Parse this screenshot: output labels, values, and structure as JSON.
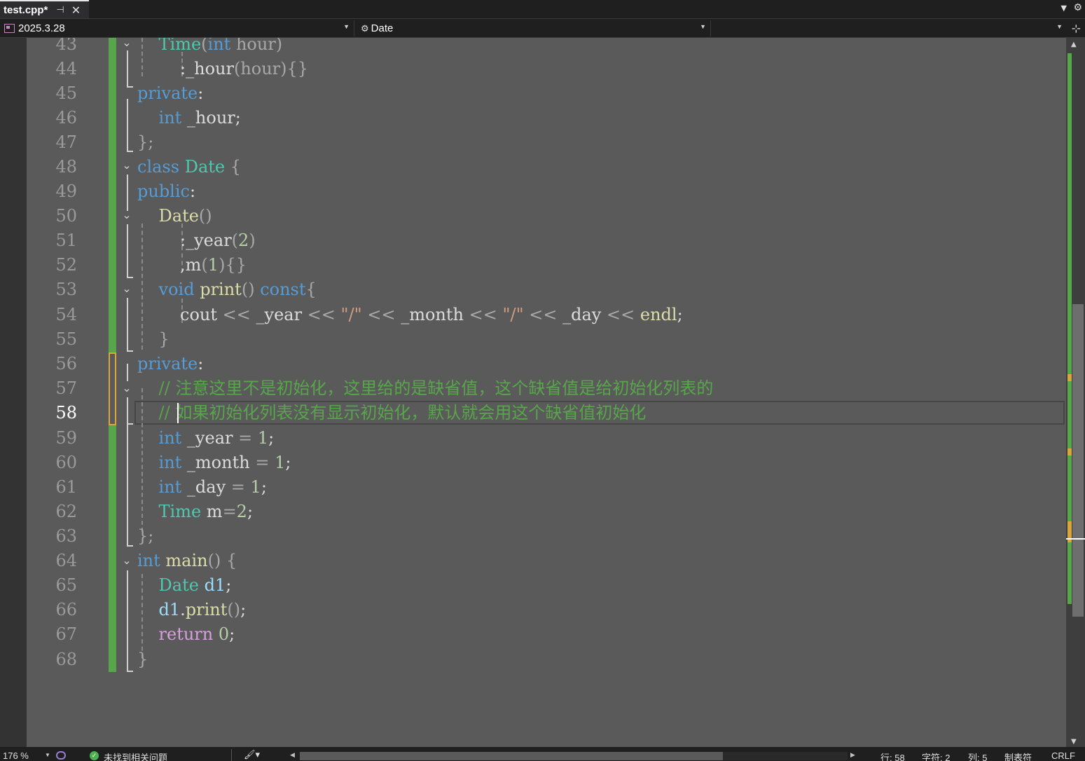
{
  "tab": {
    "title": "test.cpp*",
    "pin_icon": "pin-icon",
    "close_icon": "close-icon"
  },
  "nav": {
    "project": "2025.3.28",
    "scope": "Date",
    "member": ""
  },
  "editor": {
    "current_line": "58",
    "lines": [
      {
        "n": "43",
        "code": "    Time(int hour)"
      },
      {
        "n": "44",
        "code": "        :_hour(hour){}"
      },
      {
        "n": "45",
        "code": "private:"
      },
      {
        "n": "46",
        "code": "    int _hour;"
      },
      {
        "n": "47",
        "code": "};"
      },
      {
        "n": "48",
        "code": "class Date {"
      },
      {
        "n": "49",
        "code": "public:"
      },
      {
        "n": "50",
        "code": "    Date()"
      },
      {
        "n": "51",
        "code": "        :_year(2)"
      },
      {
        "n": "52",
        "code": "        ,m(1){}"
      },
      {
        "n": "53",
        "code": "    void print() const{"
      },
      {
        "n": "54",
        "code": "        cout << _year << \"/\" << _month << \"/\" << _day << endl;"
      },
      {
        "n": "55",
        "code": "    }"
      },
      {
        "n": "56",
        "code": "private:"
      },
      {
        "n": "57",
        "code": "    // 注意这里不是初始化，这里给的是缺省值，这个缺省值是给初始化列表的"
      },
      {
        "n": "58",
        "code": "    // 如果初始化列表没有显示初始化，默认就会用这个缺省值初始化"
      },
      {
        "n": "59",
        "code": "    int _year = 1;"
      },
      {
        "n": "60",
        "code": "    int _month = 1;"
      },
      {
        "n": "61",
        "code": "    int _day = 1;"
      },
      {
        "n": "62",
        "code": "    Time m=2;"
      },
      {
        "n": "63",
        "code": "};"
      },
      {
        "n": "64",
        "code": "int main() {"
      },
      {
        "n": "65",
        "code": "    Date d1;"
      },
      {
        "n": "66",
        "code": "    d1.print();"
      },
      {
        "n": "67",
        "code": "    return 0;"
      },
      {
        "n": "68",
        "code": "}"
      }
    ]
  },
  "status": {
    "zoom": "176 %",
    "issues": "未找到相关问题",
    "line": "行: 58",
    "char": "字符: 2",
    "col": "列: 5",
    "indent": "制表符",
    "eol": "CRLF"
  },
  "colors": {
    "keyword": "#569cd6",
    "type": "#4ec9b0",
    "function": "#dcdcaa",
    "number": "#b5cea8",
    "string": "#d69d85",
    "comment": "#57a64a",
    "control": "#d8a0df",
    "change_saved": "#57a64a",
    "change_unsaved": "#d8a63a",
    "editor_bg": "#5a5a5a"
  }
}
